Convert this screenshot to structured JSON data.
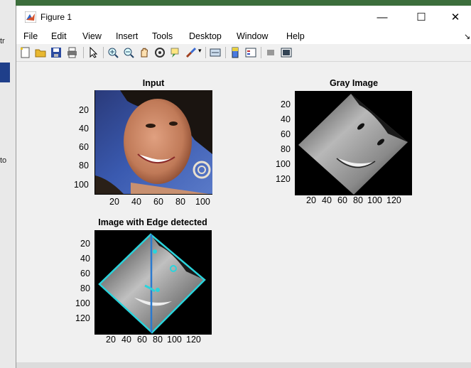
{
  "window": {
    "title": "Figure 1",
    "minimize": "—",
    "maximize": "☐",
    "close": "✕"
  },
  "menu": [
    "File",
    "Edit",
    "View",
    "Insert",
    "Tools",
    "Desktop",
    "Window",
    "Help"
  ],
  "background_fragments": [
    "tr",
    "to"
  ],
  "toolbar_icons": [
    "new-figure-icon",
    "open-file-icon",
    "save-icon",
    "print-icon",
    "pointer-icon",
    "zoom-in-icon",
    "zoom-out-icon",
    "pan-icon",
    "rotate-3d-icon",
    "data-cursor-icon",
    "brush-icon",
    "dropdown-arrow-icon",
    "link-plot-icon",
    "colorbar-icon",
    "legend-icon",
    "hide-plot-tools-icon",
    "show-plot-tools-icon"
  ],
  "plots": {
    "input": {
      "title": "Input",
      "xticks": [
        "20",
        "40",
        "60",
        "80",
        "100"
      ],
      "yticks": [
        "20",
        "40",
        "60",
        "80",
        "100"
      ]
    },
    "gray": {
      "title": "Gray Image",
      "xticks": [
        "20",
        "40",
        "60",
        "80",
        "100",
        "120"
      ],
      "yticks": [
        "20",
        "40",
        "60",
        "80",
        "100",
        "120"
      ]
    },
    "edge": {
      "title": "Image with Edge detected",
      "xticks": [
        "20",
        "40",
        "60",
        "80",
        "100",
        "120"
      ],
      "yticks": [
        "20",
        "40",
        "60",
        "80",
        "100",
        "120"
      ]
    }
  },
  "colors": {
    "edge_line": "#2ad4dc",
    "center_line": "#2a7ad0",
    "matlab_logo": "#d4502a"
  }
}
